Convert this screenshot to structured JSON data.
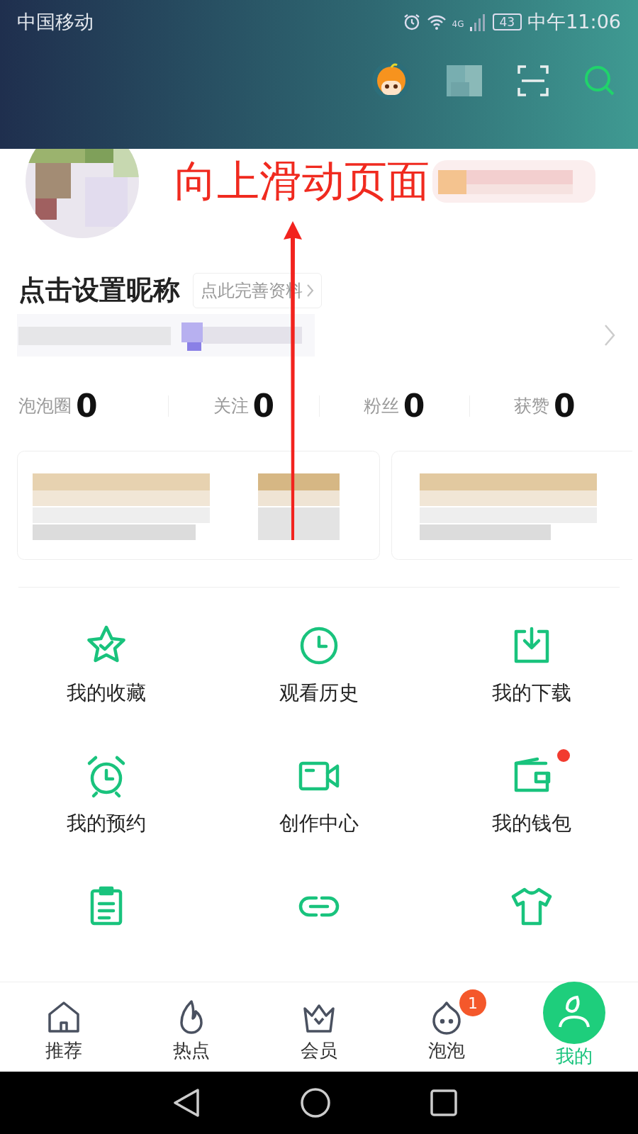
{
  "status_bar": {
    "carrier": "中国移动",
    "network": "4G",
    "battery": "43",
    "time": "中午11:06"
  },
  "profile": {
    "nickname": "点击设置昵称",
    "complete_profile": "点此完善资料"
  },
  "annotation": {
    "text": "向上滑动页面"
  },
  "stats": [
    {
      "label": "泡泡圈",
      "value": "0"
    },
    {
      "label": "关注",
      "value": "0"
    },
    {
      "label": "粉丝",
      "value": "0"
    },
    {
      "label": "获赞",
      "value": "0"
    }
  ],
  "features": [
    {
      "kind": "star",
      "label": "我的收藏",
      "dot": false
    },
    {
      "kind": "clock",
      "label": "观看历史",
      "dot": false
    },
    {
      "kind": "download",
      "label": "我的下载",
      "dot": false
    },
    {
      "kind": "alarm",
      "label": "我的预约",
      "dot": false
    },
    {
      "kind": "video",
      "label": "创作中心",
      "dot": false
    },
    {
      "kind": "wallet",
      "label": "我的钱包",
      "dot": true
    },
    {
      "kind": "clipboard",
      "dot": false
    },
    {
      "kind": "link",
      "dot": false
    },
    {
      "kind": "shirt",
      "dot": false
    }
  ],
  "tab_bar": [
    {
      "kind": "home",
      "label": "推荐",
      "selected": false
    },
    {
      "kind": "fire",
      "label": "热点",
      "selected": false
    },
    {
      "kind": "crown",
      "label": "会员",
      "selected": false
    },
    {
      "kind": "bubble",
      "label": "泡泡",
      "selected": false,
      "badge": "1"
    },
    {
      "kind": "me",
      "label": "我的",
      "selected": true
    }
  ]
}
